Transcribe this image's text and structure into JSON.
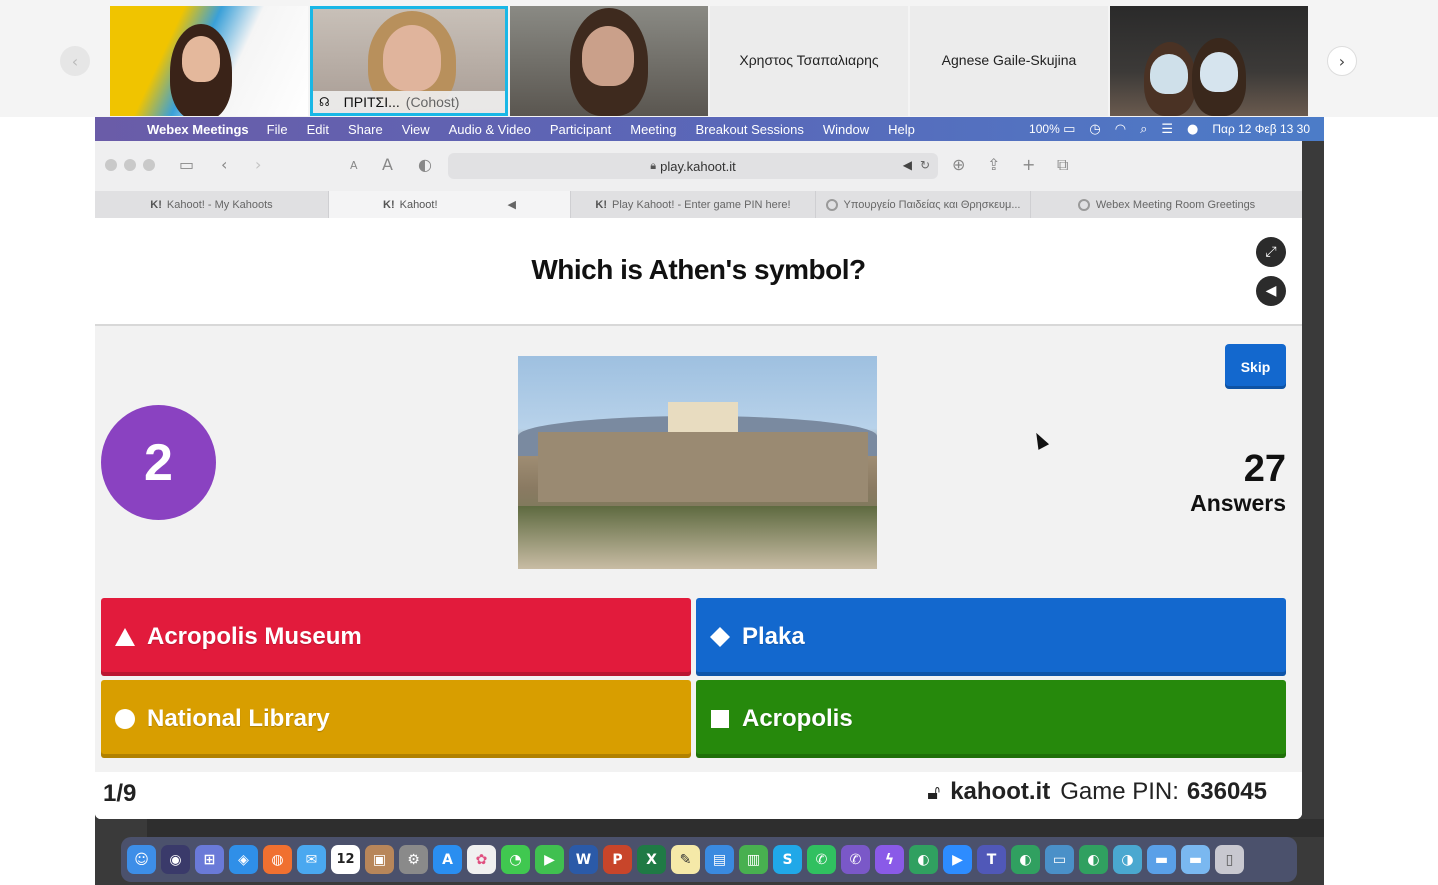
{
  "participants": {
    "tiles": [
      {
        "name": ""
      },
      {
        "name": "ΠΡΙΤΣΙ...",
        "role": "(Cohost)"
      },
      {
        "name": ""
      },
      {
        "name": "Χρηστος Τσαπαλιαρης"
      },
      {
        "name": "Agnese Gaile-Skujina"
      },
      {
        "name": ""
      }
    ]
  },
  "menubar": {
    "app": "Webex Meetings",
    "items": [
      "File",
      "Edit",
      "Share",
      "View",
      "Audio & Video",
      "Participant",
      "Meeting",
      "Breakout Sessions",
      "Window",
      "Help"
    ],
    "battery": "100%",
    "datetime": "Παρ 12 Φεβ  13 30"
  },
  "browser": {
    "url": "play.kahoot.it",
    "tabs": [
      {
        "icon": "K!",
        "label": "Kahoot! - My Kahoots"
      },
      {
        "icon": "K!",
        "label": "Kahoot!"
      },
      {
        "icon": "K!",
        "label": "Play Kahoot! - Enter game PIN here!"
      },
      {
        "icon": "globe",
        "label": "Υπουργείο Παιδείας και Θρησκευμ..."
      },
      {
        "icon": "globe",
        "label": "Webex Meeting Room Greetings"
      }
    ]
  },
  "kahoot": {
    "question": "Which is Athen's symbol?",
    "timer": "2",
    "skip_label": "Skip",
    "answer_count": "27",
    "answers_label": "Answers",
    "answers": [
      {
        "shape": "triangle",
        "label": "Acropolis Museum",
        "color": "#e21b3c"
      },
      {
        "shape": "diamond",
        "label": "Plaka",
        "color": "#1368ce"
      },
      {
        "shape": "circle",
        "label": "National Library",
        "color": "#d89e00"
      },
      {
        "shape": "square",
        "label": "Acropolis",
        "color": "#26890c"
      }
    ],
    "progress": "1/9",
    "domain": "kahoot.it",
    "pin_label": "Game PIN:",
    "pin": "636045"
  },
  "dock": {
    "calendar_day": "12"
  }
}
